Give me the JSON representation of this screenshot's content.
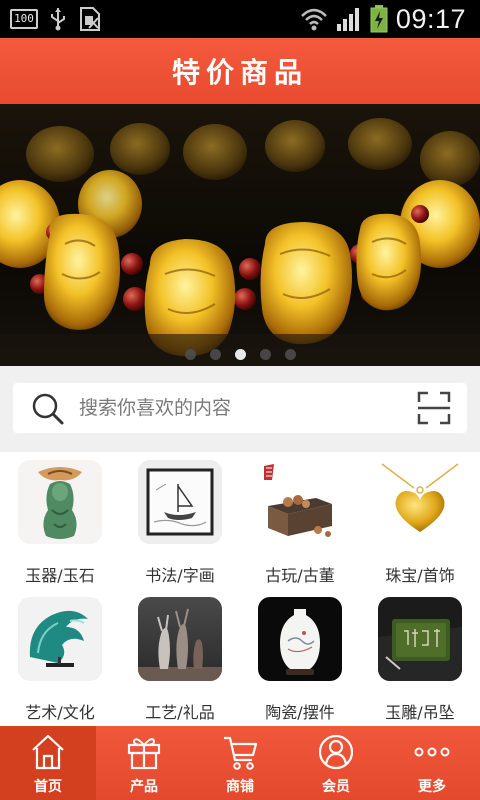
{
  "status_bar": {
    "battery_small": "100",
    "time": "09:17"
  },
  "header": {
    "title": "特价商品"
  },
  "banner": {
    "slide_count": 5,
    "active_slide": 3
  },
  "search": {
    "placeholder": "搜索你喜欢的内容"
  },
  "categories": [
    {
      "label": "玉器/玉石",
      "icon": "jade-pendant-thumbnail"
    },
    {
      "label": "书法/字画",
      "icon": "painting-thumbnail"
    },
    {
      "label": "古玩/古董",
      "icon": "antique-box-thumbnail"
    },
    {
      "label": "珠宝/首饰",
      "icon": "gold-heart-pendant-thumbnail"
    },
    {
      "label": "艺术/文化",
      "icon": "glass-wave-sculpture-thumbnail"
    },
    {
      "label": "工艺/礼品",
      "icon": "ceramic-deer-thumbnail"
    },
    {
      "label": "陶瓷/摆件",
      "icon": "porcelain-vase-thumbnail"
    },
    {
      "label": "玉雕/吊坠",
      "icon": "jade-carving-thumbnail"
    }
  ],
  "tabbar": {
    "items": [
      {
        "label": "首页",
        "icon": "home-icon"
      },
      {
        "label": "产品",
        "icon": "gift-icon"
      },
      {
        "label": "商铺",
        "icon": "cart-icon"
      },
      {
        "label": "会员",
        "icon": "user-icon"
      },
      {
        "label": "更多",
        "icon": "more-icon"
      }
    ],
    "active": 0
  },
  "colors": {
    "accent": "#ee5236",
    "tab_active": "#d3401f",
    "search_bg": "#f0f0f0"
  }
}
